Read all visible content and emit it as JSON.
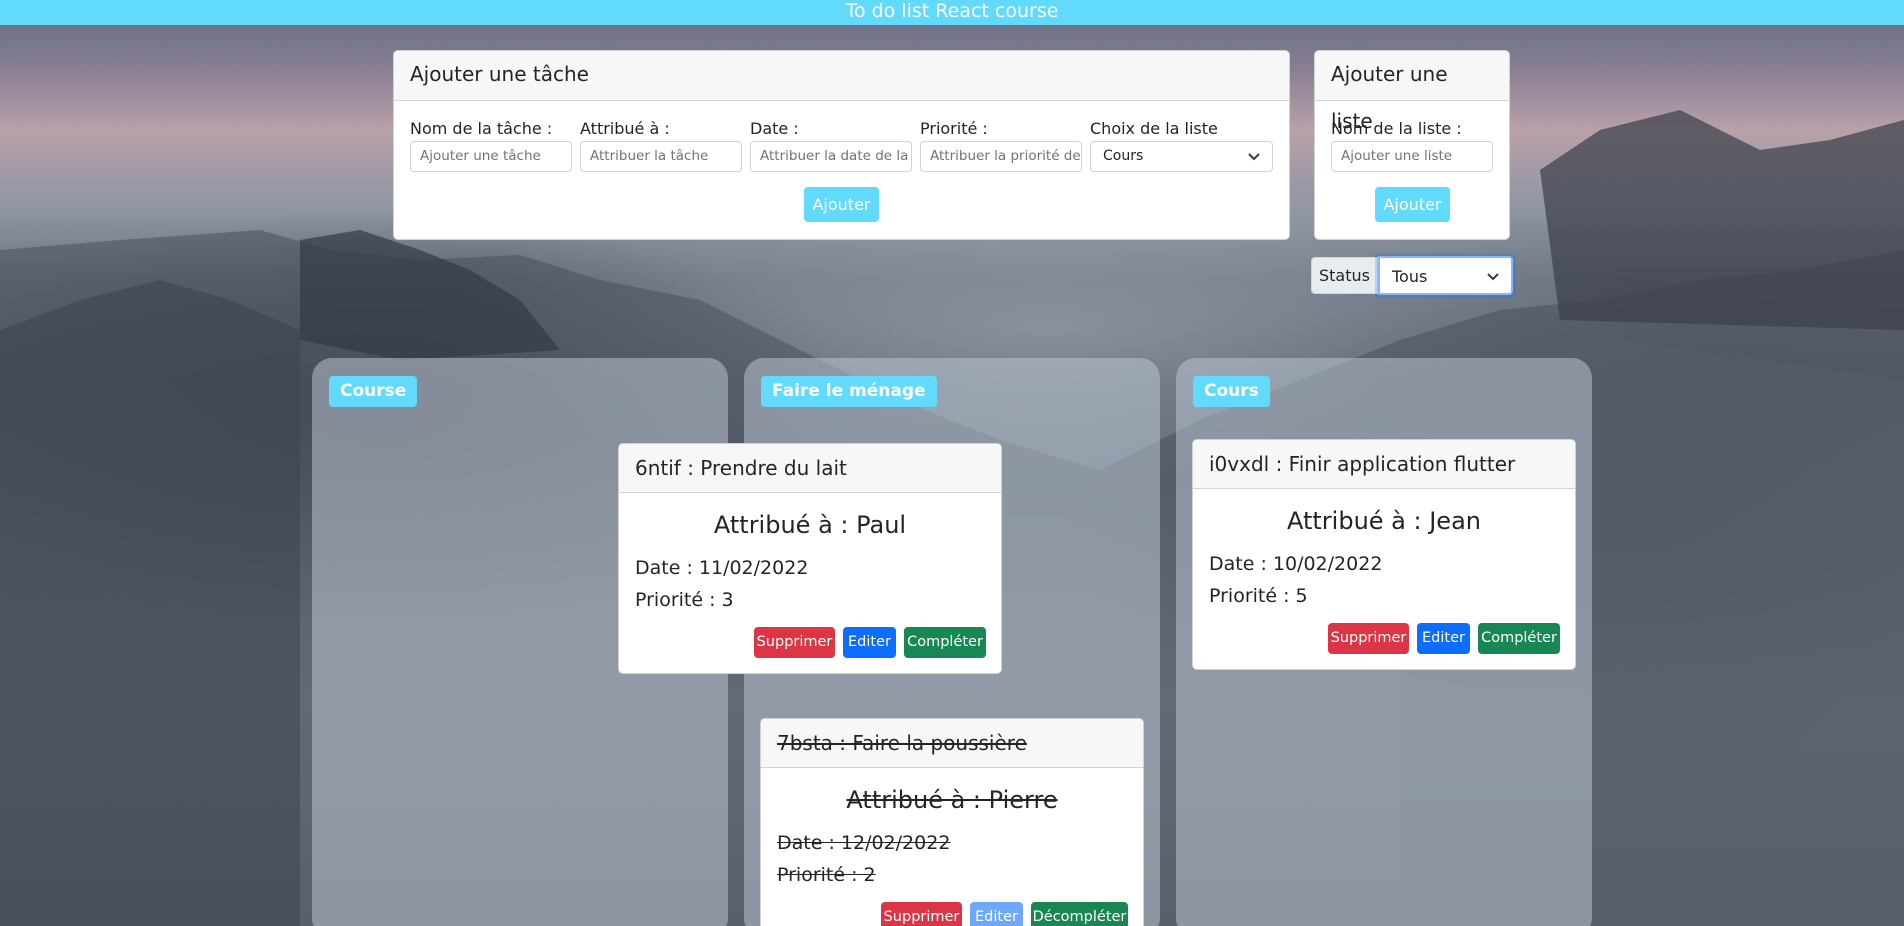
{
  "app": {
    "title": "To do list React course"
  },
  "add_task": {
    "header": "Ajouter une tâche",
    "fields": [
      {
        "label": "Nom de la tâche :",
        "placeholder": "Ajouter une tâche"
      },
      {
        "label": "Attribué à :",
        "placeholder": "Attribuer la tâche"
      },
      {
        "label": "Date :",
        "placeholder": "Attribuer la date de la tâche"
      },
      {
        "label": "Priorité :",
        "placeholder": "Attribuer la priorité de la tâche"
      }
    ],
    "list_choice": {
      "label": "Choix de la liste",
      "value": "Cours"
    },
    "submit_label": "Ajouter"
  },
  "add_list": {
    "header": "Ajouter une liste",
    "field": {
      "label": "Nom de la liste :",
      "placeholder": "Ajouter une liste"
    },
    "submit_label": "Ajouter"
  },
  "status_filter": {
    "label": "Status",
    "value": "Tous"
  },
  "lists": [
    {
      "name": "Course",
      "tasks": []
    },
    {
      "name": "Faire le ménage",
      "tasks": [
        {
          "title": "6ntif : Prendre du lait",
          "assigned": "Attribué à : Paul",
          "date": "Date : 11/02/2022",
          "priority": "Priorité : 3",
          "completed": false,
          "buttons": {
            "delete": "Supprimer",
            "edit": "Editer",
            "toggle": "Compléter"
          }
        },
        {
          "title": "7bsta : Faire la poussière",
          "assigned": "Attribué à : Pierre",
          "date": "Date : 12/02/2022",
          "priority": "Priorité : 2",
          "completed": true,
          "buttons": {
            "delete": "Supprimer",
            "edit": "Editer",
            "toggle": "Décompléter"
          }
        }
      ]
    },
    {
      "name": "Cours",
      "tasks": [
        {
          "title": "i0vxdl : Finir application flutter",
          "assigned": "Attribué à : Jean",
          "date": "Date : 10/02/2022",
          "priority": "Priorité : 5",
          "completed": false,
          "buttons": {
            "delete": "Supprimer",
            "edit": "Editer",
            "toggle": "Compléter"
          }
        }
      ]
    }
  ],
  "colors": {
    "accent": "#61dafb",
    "danger": "#dc3545",
    "primary": "#0d6efd",
    "success": "#198754"
  },
  "icons": {
    "select_arrow": "chevron-down-icon"
  }
}
